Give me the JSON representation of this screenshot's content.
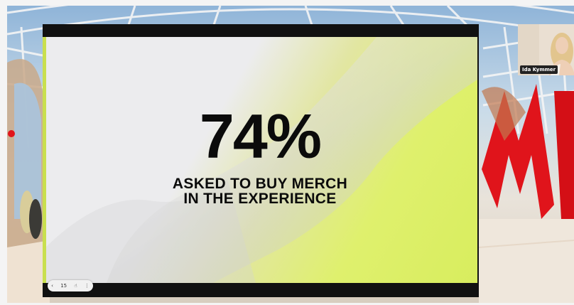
{
  "slide": {
    "stat": "74%",
    "caption_line1": "ASKED TO BUY MERCH",
    "caption_line2": "IN THE EXPERIENCE"
  },
  "pager": {
    "prev_icon": "chevron-left-icon",
    "page_number": "15",
    "pointer_icon": "hand-pointer-icon",
    "more_icon": "more-vertical-icon"
  },
  "video": {
    "participant_name": "Ida Kymmer"
  },
  "colors": {
    "accent_yellow": "#dff06d",
    "backdrop_red": "#e0141b"
  }
}
